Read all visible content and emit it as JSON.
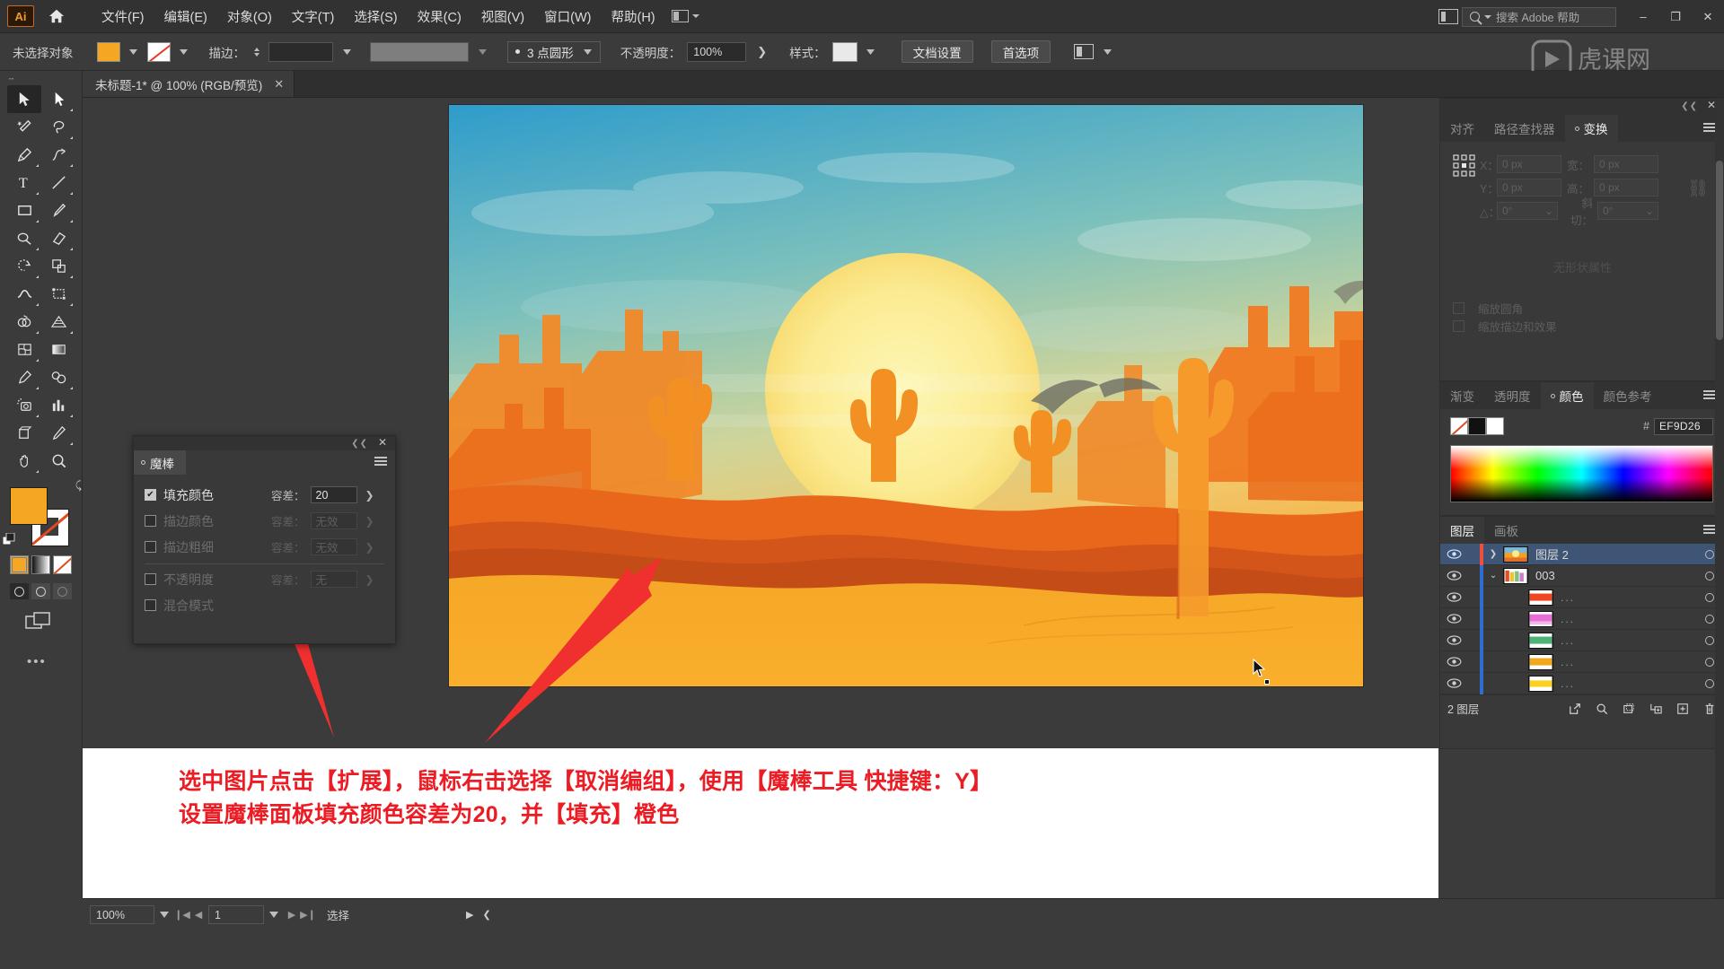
{
  "app": {
    "name": "Adobe Illustrator",
    "logo_text": "Ai"
  },
  "menubar": {
    "home_icon": "home-icon",
    "items": [
      {
        "label": "文件(F)"
      },
      {
        "label": "编辑(E)"
      },
      {
        "label": "对象(O)"
      },
      {
        "label": "文字(T)"
      },
      {
        "label": "选择(S)"
      },
      {
        "label": "效果(C)"
      },
      {
        "label": "视图(V)"
      },
      {
        "label": "窗口(W)"
      },
      {
        "label": "帮助(H)"
      }
    ],
    "search_placeholder": "搜索 Adobe 帮助",
    "window_controls": {
      "minimize": "–",
      "restore": "❐",
      "close": "✕"
    }
  },
  "controlbar": {
    "selection_status": "未选择对象",
    "stroke_label": "描边：",
    "stroke_weight": "",
    "profile_label": "3 点圆形",
    "opacity_label": "不透明度：",
    "opacity_value": "100%",
    "style_label": "样式：",
    "doc_setup_button": "文档设置",
    "preferences_button": "首选项"
  },
  "tabbar": {
    "document_tab": "未标题-1* @ 100% (RGB/预览)",
    "close": "✕"
  },
  "toolbar": {
    "tools": [
      {
        "name": "selection-tool",
        "selected": true
      },
      {
        "name": "direct-selection-tool",
        "selected": false
      },
      {
        "name": "magic-wand-tool",
        "selected": false
      },
      {
        "name": "lasso-tool",
        "selected": false
      },
      {
        "name": "pen-tool",
        "selected": false
      },
      {
        "name": "curvature-tool",
        "selected": false
      },
      {
        "name": "type-tool",
        "selected": false
      },
      {
        "name": "line-segment-tool",
        "selected": false
      },
      {
        "name": "rectangle-tool",
        "selected": false
      },
      {
        "name": "paintbrush-tool",
        "selected": false
      },
      {
        "name": "shaper-tool",
        "selected": false
      },
      {
        "name": "eraser-tool",
        "selected": false
      },
      {
        "name": "rotate-tool",
        "selected": false
      },
      {
        "name": "scale-tool",
        "selected": false
      },
      {
        "name": "width-tool",
        "selected": false
      },
      {
        "name": "free-transform-tool",
        "selected": false
      },
      {
        "name": "shape-builder-tool",
        "selected": false
      },
      {
        "name": "perspective-grid-tool",
        "selected": false
      },
      {
        "name": "mesh-tool",
        "selected": false
      },
      {
        "name": "gradient-tool",
        "selected": false
      },
      {
        "name": "eyedropper-tool",
        "selected": false
      },
      {
        "name": "blend-tool",
        "selected": false
      },
      {
        "name": "symbol-sprayer-tool",
        "selected": false
      },
      {
        "name": "column-graph-tool",
        "selected": false
      },
      {
        "name": "artboard-tool",
        "selected": false
      },
      {
        "name": "slice-tool",
        "selected": false
      },
      {
        "name": "hand-tool",
        "selected": false
      },
      {
        "name": "zoom-tool",
        "selected": false
      }
    ],
    "fill_color": "#F5A623",
    "stroke_color": "#FFFFFF",
    "draw_modes": [
      "draw-normal",
      "draw-behind",
      "draw-inside"
    ]
  },
  "wand_panel": {
    "title": "魔棒",
    "close": "✕",
    "rows": [
      {
        "label": "填充颜色",
        "checked": true,
        "tol_label": "容差：",
        "tol_value": "20",
        "enabled": true
      },
      {
        "label": "描边颜色",
        "checked": false,
        "tol_label": "容差：",
        "tol_value": "无效",
        "enabled": false
      },
      {
        "label": "描边粗细",
        "checked": false,
        "tol_label": "容差：",
        "tol_value": "无效",
        "enabled": false
      },
      {
        "label": "不透明度",
        "checked": false,
        "tol_label": "容差：",
        "tol_value": "无",
        "enabled": false
      },
      {
        "label": "混合模式",
        "checked": false,
        "tol_label": "",
        "tol_value": "",
        "enabled": false
      }
    ]
  },
  "transform_panel": {
    "tabs": [
      {
        "label": "对齐",
        "active": false
      },
      {
        "label": "路径查找器",
        "active": false
      },
      {
        "label": "变换",
        "active": true
      }
    ],
    "fields": {
      "x_label": "X：",
      "x_value": "0 px",
      "y_label": "Y：",
      "y_value": "0 px",
      "w_label": "宽：",
      "w_value": "0 px",
      "h_label": "高：",
      "h_value": "0 px",
      "angle_label": "△：",
      "angle_value": "0°",
      "shear_label": "斜切：",
      "shear_value": "0°"
    },
    "checkboxes": [
      {
        "label": "缩放圆角"
      },
      {
        "label": "缩放描边和效果"
      }
    ],
    "empty_text": "无形状属性"
  },
  "color_panel": {
    "tabs": [
      {
        "label": "渐变",
        "active": false
      },
      {
        "label": "透明度",
        "active": false
      },
      {
        "label": "颜色",
        "active": true
      },
      {
        "label": "颜色参考",
        "active": false
      }
    ],
    "hash": "#",
    "hex_value": "EF9D26",
    "swatches": [
      "none",
      "#111111",
      "#FFFFFF"
    ]
  },
  "layers_panel": {
    "tabs": [
      {
        "label": "图层",
        "active": true
      },
      {
        "label": "画板",
        "active": false
      }
    ],
    "rows": [
      {
        "name": "图层 2",
        "selected": true,
        "indent": 0,
        "expanded": false,
        "color": "#ef4f3c",
        "thumb": "sunset"
      },
      {
        "name": "003",
        "selected": false,
        "indent": 1,
        "expanded": true,
        "color": "#2f6dd0",
        "thumb": "multi"
      },
      {
        "name": "...",
        "selected": false,
        "indent": 2,
        "expanded": null,
        "color": "#2f6dd0",
        "thumb": "red"
      },
      {
        "name": "...",
        "selected": false,
        "indent": 2,
        "expanded": null,
        "color": "#2f6dd0",
        "thumb": "magenta"
      },
      {
        "name": "...",
        "selected": false,
        "indent": 2,
        "expanded": null,
        "color": "#2f6dd0",
        "thumb": "green"
      },
      {
        "name": "...",
        "selected": false,
        "indent": 2,
        "expanded": null,
        "color": "#2f6dd0",
        "thumb": "orange"
      },
      {
        "name": "...",
        "selected": false,
        "indent": 2,
        "expanded": null,
        "color": "#2f6dd0",
        "thumb": "yellow"
      }
    ],
    "footer_count": "2 图层",
    "footer_buttons": [
      "locate-object",
      "make-clipping-mask",
      "create-sublayer",
      "new-layer",
      "delete-layer"
    ]
  },
  "statusbar": {
    "zoom_value": "100%",
    "page_value": "1",
    "status_text": "选择"
  },
  "caption": {
    "line1": "选中图片点击【扩展】，鼠标右击选择【取消编组】，使用【魔棒工具 快捷键：Y】",
    "line2": "设置魔棒面板填充颜色容差为20，并【填充】橙色",
    "color": "#EC1C24"
  },
  "artwork": {
    "title": "沙漠日落插画",
    "colors": {
      "sky_top": "#3ba4d0",
      "sky_mid": "#8fc9b5",
      "sun": "#fdf3a8",
      "sand": "#f6a126",
      "rock_dark": "#d6541a",
      "rock_mid": "#ef7322"
    }
  }
}
